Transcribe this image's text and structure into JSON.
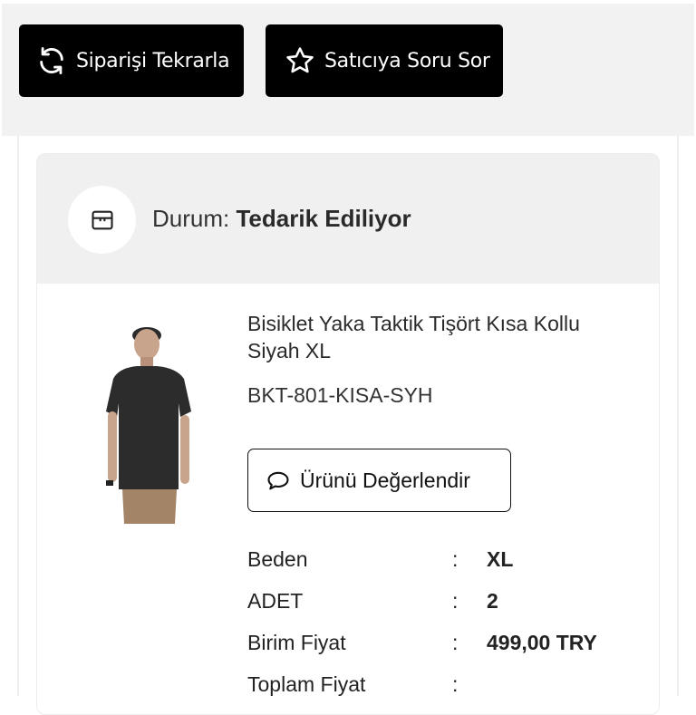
{
  "actions": {
    "reorder_label": "Siparişi Tekrarla",
    "ask_seller_label": "Satıcıya Soru Sor"
  },
  "status": {
    "label": "Durum:",
    "value": "Tedarik Ediliyor"
  },
  "product": {
    "title": "Bisiklet Yaka Taktik Tişört Kısa Kollu Siyah XL",
    "sku": "BKT-801-KISA-SYH",
    "review_label": "Ürünü Değerlendir",
    "specs": [
      {
        "label": "Beden",
        "value": "XL"
      },
      {
        "label": "ADET",
        "value": "2"
      },
      {
        "label": "Birim Fiyat",
        "value": "499,00 TRY"
      },
      {
        "label": "Toplam Fiyat",
        "value": ""
      }
    ]
  },
  "icons": {
    "reorder": "refresh-icon",
    "ask_seller": "star-icon",
    "status": "box-icon",
    "review": "chat-bubble-icon"
  }
}
